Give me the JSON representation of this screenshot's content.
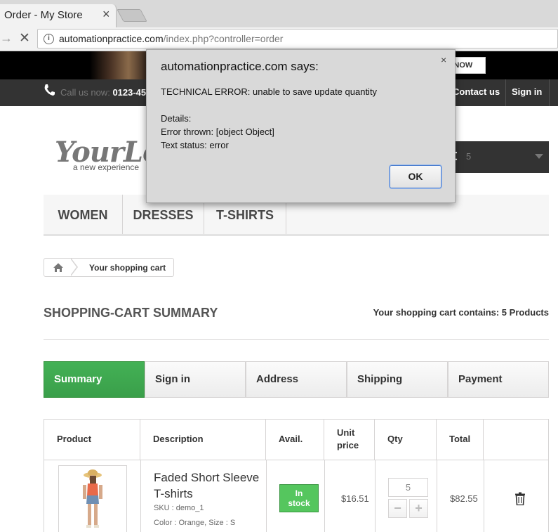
{
  "browser": {
    "tab_title": "Order - My Store",
    "tab_close": "×",
    "url_host": "automationpractice.com",
    "url_path": "/index.php?controller=order"
  },
  "banner": {
    "button_label": "SS NOW"
  },
  "topbar": {
    "call_label": "Call us now:",
    "phone": "0123-45",
    "contact_label": "Contact us",
    "signin_label": "Sign in"
  },
  "logo": {
    "title": "YourLo",
    "tagline": "a new experience"
  },
  "cart": {
    "letter": "t",
    "count": "5"
  },
  "menu": [
    "WOMEN",
    "DRESSES",
    "T-SHIRTS"
  ],
  "breadcrumb": {
    "label": "Your shopping cart"
  },
  "page": {
    "heading": "SHOPPING-CART SUMMARY",
    "cart_contains": "Your shopping cart contains: 5 Products"
  },
  "steps": [
    "Summary",
    "Sign in",
    "Address",
    "Shipping",
    "Payment"
  ],
  "table": {
    "headers": [
      "Product",
      "Description",
      "Avail.",
      "Unit\nprice",
      "Qty",
      "Total"
    ],
    "row": {
      "name": "Faded Short Sleeve T-shirts",
      "sku": "SKU : demo_1",
      "attributes": "Color : Orange, Size : S",
      "stock_line1": "In",
      "stock_line2": "stock",
      "unit_price": "$16.51",
      "qty": "5",
      "minus": "−",
      "plus": "+",
      "total": "$82.55"
    }
  },
  "dialog": {
    "title": "automationpractice.com says:",
    "close": "×",
    "message": "TECHNICAL ERROR: unable to save update quantity\n\nDetails:\nError thrown: [object Object]\nText status: error",
    "ok_label": "OK"
  },
  "colors": {
    "step_active": "#43b155",
    "stock_badge": "#55c65e",
    "topbar": "#333333",
    "dialog_bg": "#d9d9d9",
    "ok_border": "#4d7fd0"
  }
}
